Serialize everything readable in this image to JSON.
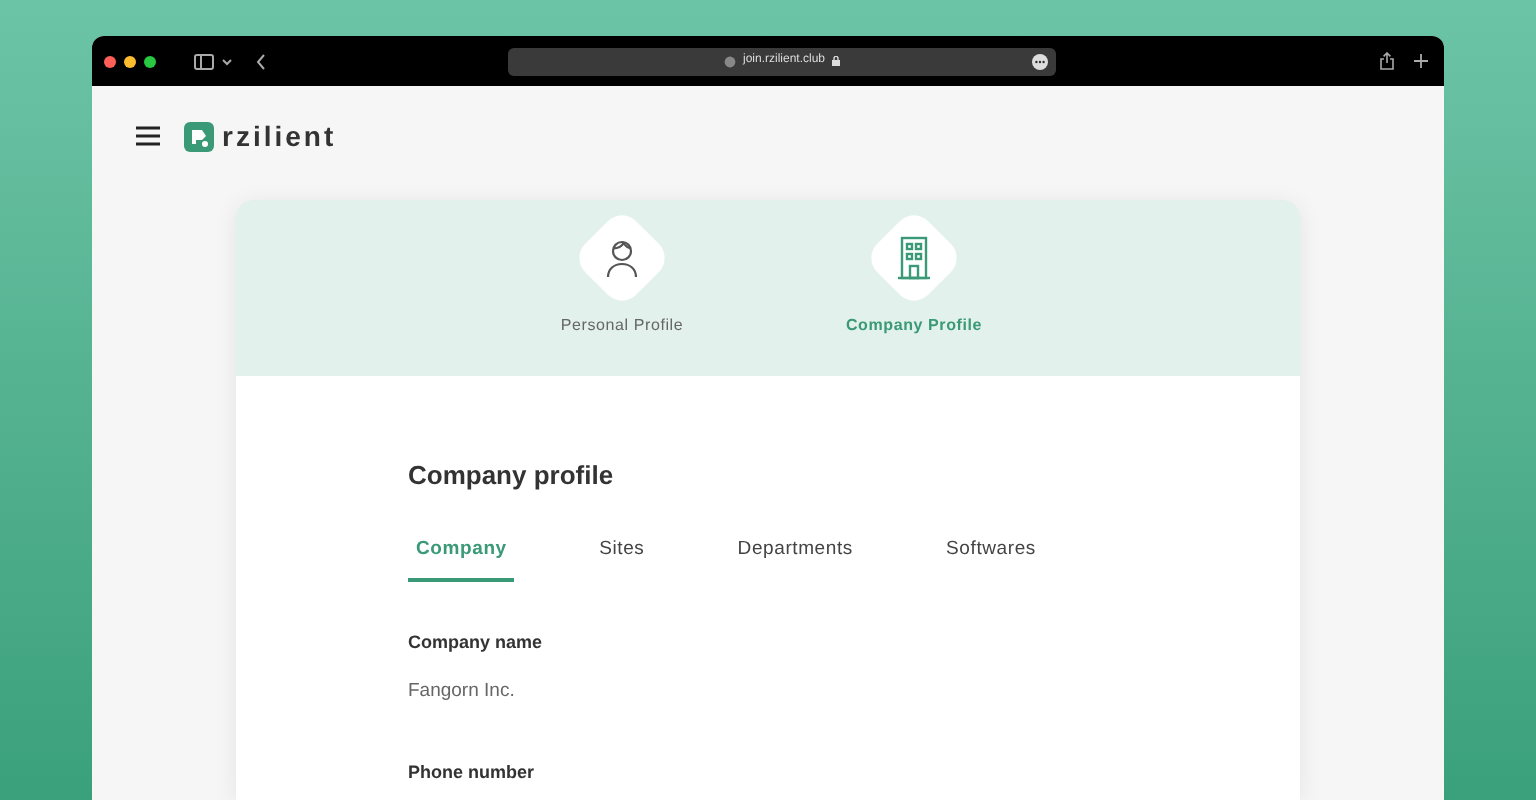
{
  "browser": {
    "url": "join.rzilient.club"
  },
  "header": {
    "logo_text": "rzilient"
  },
  "steps": [
    {
      "kind": "person",
      "label": "Personal Profile",
      "selected": false
    },
    {
      "kind": "building",
      "label": "Company Profile",
      "selected": true
    }
  ],
  "form": {
    "title": "Company profile",
    "tabs": [
      {
        "label": "Company",
        "selected": true
      },
      {
        "label": "Sites",
        "selected": false
      },
      {
        "label": "Departments",
        "selected": false
      },
      {
        "label": "Softwares",
        "selected": false
      }
    ],
    "fields": [
      {
        "label": "Company name",
        "value": "Fangorn Inc."
      },
      {
        "label": "Phone number"
      }
    ]
  }
}
